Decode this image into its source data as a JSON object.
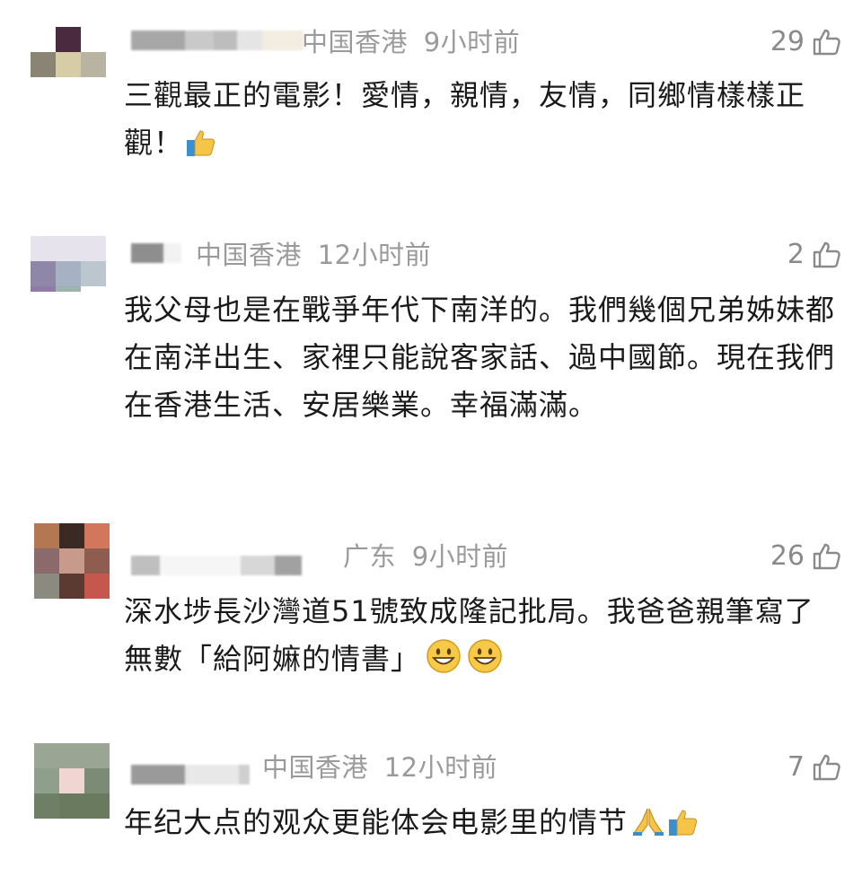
{
  "comments": [
    {
      "region": "中国香港",
      "time": "9小时前",
      "likes": "29",
      "text": "三觀最正的電影！愛情，親情，友情，同鄉情樣樣正觀！",
      "emoji": [
        "thumbs-up"
      ],
      "avatar_colors": [
        "#ffffff",
        "#4a2a3e",
        "#ffffff",
        "#8a8472",
        "#d6cda7",
        "#b9b3a2",
        "#ffffff",
        "#ffffff",
        "#ffffff"
      ]
    },
    {
      "region": "中国香港",
      "time": "12小时前",
      "likes": "2",
      "text": "我父母也是在戰爭年代下南洋的。我們幾個兄弟姊妹都在南洋出生、家裡只能說客家話、過中國節。現在我們在香港生活、安居樂業。幸福滿滿。",
      "emoji": [],
      "avatar_colors": [
        "#e7e3ec",
        "#e7e3ec",
        "#e7e3ec",
        "#8f87a8",
        "#a7b1c4",
        "#bcc6cf",
        "#8f7aaa",
        "#9db3ad",
        "#ffffff"
      ]
    },
    {
      "region": "广东",
      "time": "9小时前",
      "likes": "26",
      "text": "深水埗長沙灣道51號致成隆記批局。我爸爸親筆寫了無數「給阿嫲的情書」",
      "emoji": [
        "grinning",
        "grinning"
      ],
      "avatar_colors": [
        "#b37851",
        "#3b2a24",
        "#d3775c",
        "#8a6a6a",
        "#c89a8c",
        "#8f5d50",
        "#8a8a80",
        "#5b3a32",
        "#c4584c"
      ]
    },
    {
      "region": "中国香港",
      "time": "12小时前",
      "likes": "7",
      "text": "年纪大点的观众更能体会电影里的情节",
      "emoji": [
        "praying-hands",
        "thumbs-up"
      ],
      "avatar_colors": [
        "#9aa593",
        "#9aa593",
        "#9aa593",
        "#8ea08b",
        "#f0d6d2",
        "#7b8b76",
        "#6f7f67",
        "#6a7a5f",
        "#6a7a5f"
      ]
    }
  ]
}
